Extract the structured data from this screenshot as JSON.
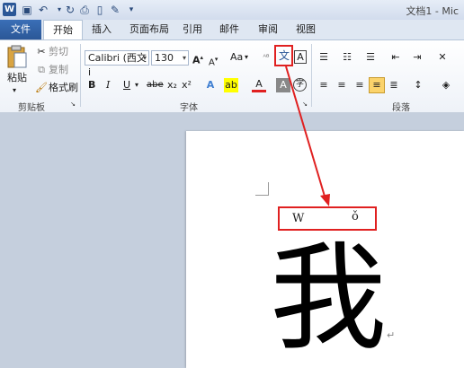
{
  "window": {
    "title": "文档1 - Mic",
    "app_icon": "W"
  },
  "quick_access": {
    "icons": [
      "save-icon",
      "undo-icon",
      "redo-icon",
      "print-preview-icon",
      "new-document-icon",
      "spelling-check-icon",
      "customize-icon"
    ]
  },
  "tabs": [
    {
      "label": "文件"
    },
    {
      "label": "开始"
    },
    {
      "label": "插入"
    },
    {
      "label": "页面布局"
    },
    {
      "label": "引用"
    },
    {
      "label": "邮件"
    },
    {
      "label": "审阅"
    },
    {
      "label": "视图"
    }
  ],
  "clipboard": {
    "paste": "粘贴",
    "cut": "剪切",
    "copy": "复制",
    "format_painter": "格式刷",
    "group": "剪贴板"
  },
  "font": {
    "name": "Calibri (西文i",
    "size": "130",
    "grow": "A",
    "shrink": "A",
    "change_case": "Aa",
    "bold": "B",
    "italic": "I",
    "underline": "U",
    "strike": "abe",
    "subscript": "x₂",
    "superscript": "x²",
    "group": "字体"
  },
  "paragraph": {
    "group": "段落"
  },
  "document": {
    "phonetic_preview_base": "W",
    "phonetic_preview_ruby": "ǒ",
    "main_text": "我",
    "paragraph_mark": "↵"
  },
  "colors": {
    "highlight_box": "#e02020",
    "accent": "#2b5797"
  }
}
